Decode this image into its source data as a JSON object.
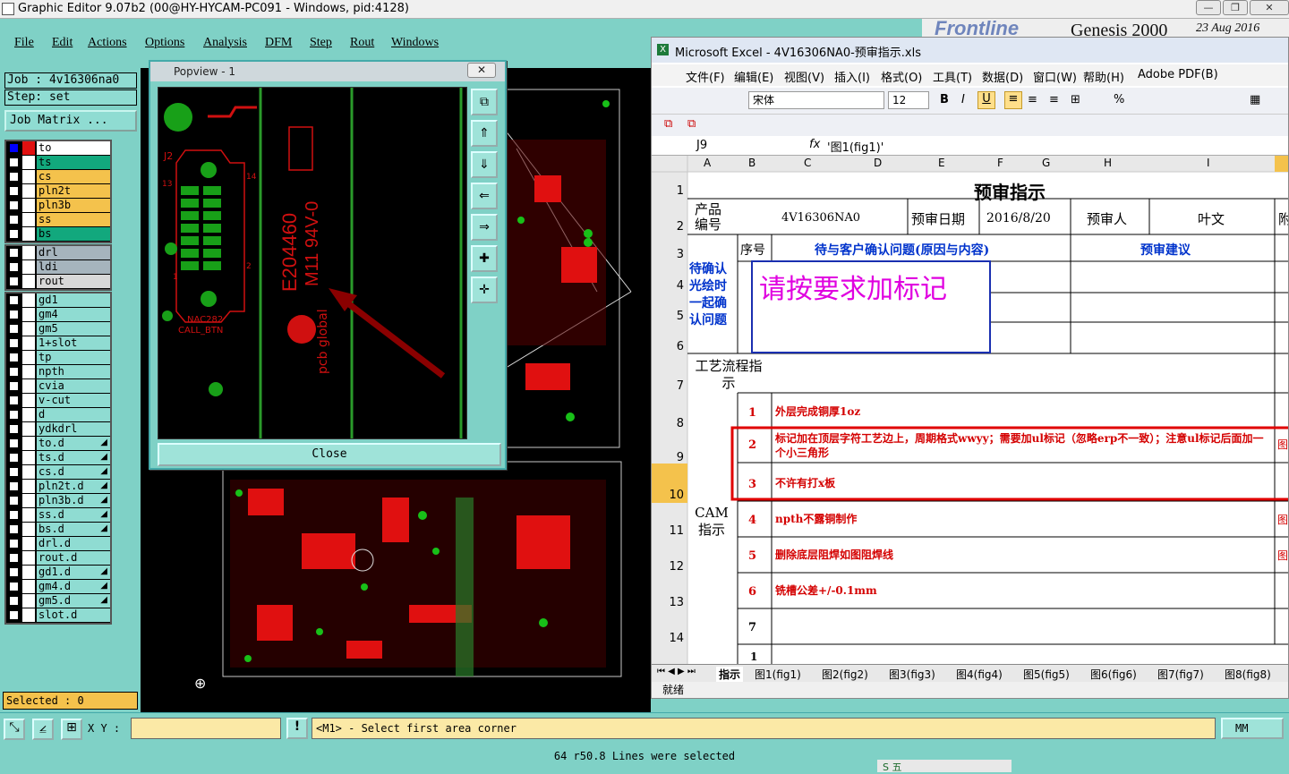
{
  "app": {
    "title": "Graphic Editor 9.07b2 (00@HY-HYCAM-PC091 - Windows, pid:4128)",
    "menu": [
      "File",
      "Edit",
      "Actions",
      "Options",
      "Analysis",
      "DFM",
      "Step",
      "Rout",
      "Windows"
    ]
  },
  "job": {
    "job_label": "Job : 4v16306na0",
    "step_label": "Step: set",
    "matrix_button": "Job Matrix ..."
  },
  "layers_group1": [
    {
      "name": "to",
      "color": "#ffffff"
    },
    {
      "name": "ts",
      "color": "#12a87d"
    },
    {
      "name": "cs",
      "color": "#f4c24c"
    },
    {
      "name": "pln2t",
      "color": "#f4c24c"
    },
    {
      "name": "pln3b",
      "color": "#f4c24c"
    },
    {
      "name": "ss",
      "color": "#f4c24c"
    },
    {
      "name": "bs",
      "color": "#12a87d"
    }
  ],
  "layers_group2": [
    {
      "name": "drl",
      "color": "#a6b4bd"
    },
    {
      "name": "ldi",
      "color": "#a6b4bd"
    },
    {
      "name": "rout",
      "color": "#d8d8d8"
    }
  ],
  "layers_group3": [
    {
      "name": "gd1",
      "color": "#8fdcd2",
      "arrow": ""
    },
    {
      "name": "gm4",
      "color": "#8fdcd2",
      "arrow": ""
    },
    {
      "name": "gm5",
      "color": "#8fdcd2",
      "arrow": ""
    },
    {
      "name": "1+slot",
      "color": "#8fdcd2",
      "arrow": ""
    },
    {
      "name": "tp",
      "color": "#8fdcd2",
      "arrow": ""
    },
    {
      "name": "npth",
      "color": "#8fdcd2",
      "arrow": ""
    },
    {
      "name": "cvia",
      "color": "#8fdcd2",
      "arrow": ""
    },
    {
      "name": "v-cut",
      "color": "#8fdcd2",
      "arrow": ""
    },
    {
      "name": "d",
      "color": "#8fdcd2",
      "arrow": ""
    },
    {
      "name": "ydkdrl",
      "color": "#8fdcd2",
      "arrow": ""
    },
    {
      "name": "to.d",
      "color": "#8fdcd2",
      "arrow": "◢"
    },
    {
      "name": "ts.d",
      "color": "#8fdcd2",
      "arrow": "◢"
    },
    {
      "name": "cs.d",
      "color": "#8fdcd2",
      "arrow": "◢"
    },
    {
      "name": "pln2t.d",
      "color": "#8fdcd2",
      "arrow": "◢"
    },
    {
      "name": "pln3b.d",
      "color": "#8fdcd2",
      "arrow": "◢"
    },
    {
      "name": "ss.d",
      "color": "#8fdcd2",
      "arrow": "◢"
    },
    {
      "name": "bs.d",
      "color": "#8fdcd2",
      "arrow": "◢"
    },
    {
      "name": "drl.d",
      "color": "#8fdcd2",
      "arrow": ""
    },
    {
      "name": "rout.d",
      "color": "#8fdcd2",
      "arrow": ""
    },
    {
      "name": "gd1.d",
      "color": "#8fdcd2",
      "arrow": "◢"
    },
    {
      "name": "gm4.d",
      "color": "#8fdcd2",
      "arrow": "◢"
    },
    {
      "name": "gm5.d",
      "color": "#8fdcd2",
      "arrow": "◢"
    },
    {
      "name": "slot.d",
      "color": "#8fdcd2",
      "arrow": ""
    }
  ],
  "selected_label": "Selected : 0",
  "popview": {
    "title": "Popview - 1",
    "close": "Close",
    "pcb_texts": {
      "j2": "J2",
      "pin13": "13",
      "pin1": "1",
      "pin2": "2",
      "pin14": "14",
      "e": "E204460",
      "m": "M11 94V-0",
      "nac": "NAC282",
      "call": "CALL_BTN",
      "logo": "pcb global"
    }
  },
  "genesis": {
    "brand": "Frontline",
    "product": "Genesis 2000",
    "date": "23 Aug 2016",
    "sub": "Graphic Editor"
  },
  "excel": {
    "title": "Microsoft Excel - 4V16306NA0-预审指示.xls",
    "menu": [
      "文件(F)",
      "编辑(E)",
      "视图(V)",
      "插入(I)",
      "格式(O)",
      "工具(T)",
      "数据(D)",
      "窗口(W)",
      "帮助(H)",
      "Adobe PDF(B)"
    ],
    "font": "宋体",
    "size": "12",
    "cell_ref": "J9",
    "formula": "'图1(fig1)'",
    "columns": [
      "A",
      "B",
      "C",
      "D",
      "E",
      "F",
      "G",
      "H",
      "I"
    ],
    "rows": [
      "1",
      "2",
      "3",
      "4",
      "5",
      "6",
      "7",
      "8",
      "9",
      "10",
      "11",
      "12",
      "13",
      "14"
    ],
    "sheet_title": "预审指示",
    "product_label": "产品编号",
    "product_no": "4V16306NA0",
    "date_label": "预审日期",
    "date": "2016/8/20",
    "reviewer_label": "预审人",
    "reviewer": "叶文",
    "attach": "附",
    "seq": "序号",
    "question_header": "待与客户确认问题(原因与内容)",
    "suggest_header": "预审建议",
    "confirm_label": "待确认光绘时一起确认问题",
    "note": "请按要求加标记",
    "process_label": "工艺流程指示",
    "cam_label": "CAM指示",
    "items": [
      {
        "n": "1",
        "text": "外层完成铜厚1oz",
        "ref": ""
      },
      {
        "n": "2",
        "text": "标记加在顶层字符工艺边上，周期格式wwyy；需要加ul标记（忽略erp不一致）；注意ul标记后面加一个小三角形",
        "ref": "图"
      },
      {
        "n": "3",
        "text": "不许有打x板",
        "ref": ""
      },
      {
        "n": "4",
        "text": "npth不露铜制作",
        "ref": "图"
      },
      {
        "n": "5",
        "text": "删除底层阻焊如图阻焊线",
        "ref": "图"
      },
      {
        "n": "6",
        "text": "铣槽公差+/-0.1mm",
        "ref": ""
      },
      {
        "n": "7",
        "text": "",
        "ref": ""
      }
    ],
    "row15_partial": "1",
    "tabs": [
      "指示",
      "图1(fig1)",
      "图2(fig2)",
      "图3(fig3)",
      "图4(fig4)",
      "图5(fig5)",
      "图6(fig6)",
      "图7(fig7)",
      "图8(fig8)"
    ],
    "status": "就绪"
  },
  "bottom": {
    "xy_label": "X Y :",
    "prompt": "<M1> - Select first area corner",
    "units": "MM",
    "status": "64 r50.8 Lines were selected"
  },
  "taskbar": {
    "ime": "S 五"
  }
}
